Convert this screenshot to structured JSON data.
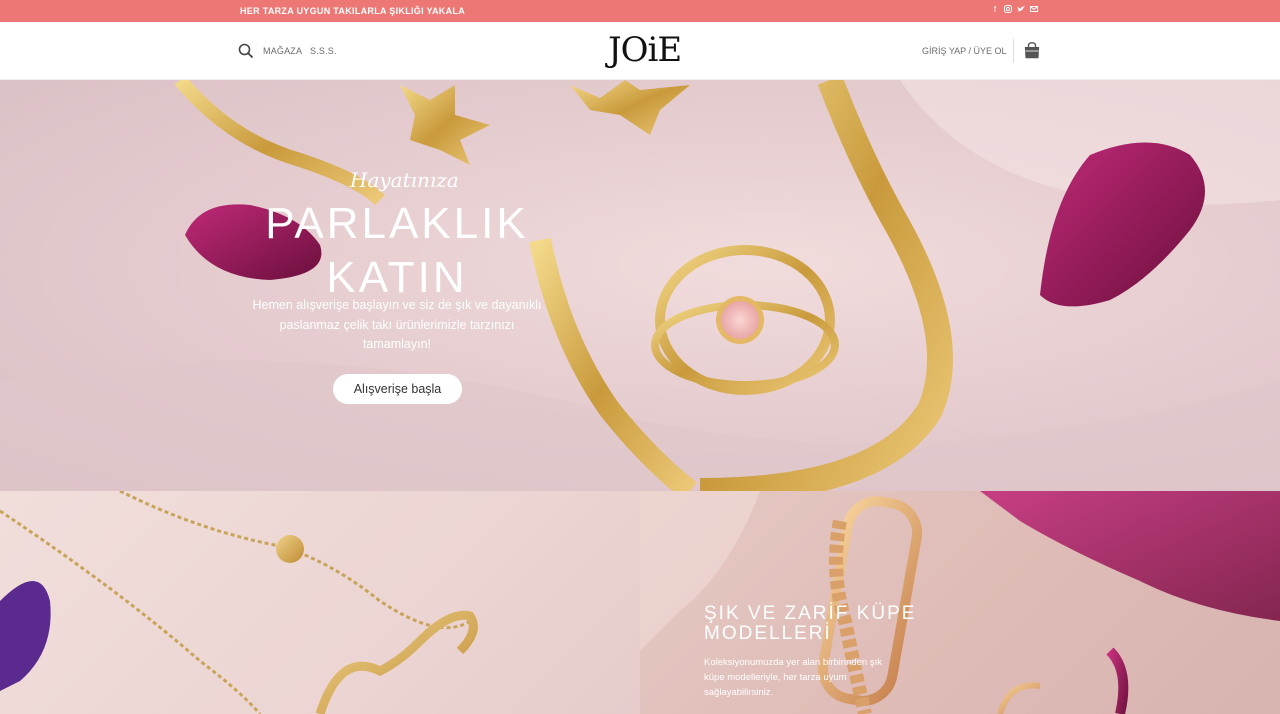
{
  "topbar": {
    "promo": "HER TARZA UYGUN TAKILARLA ŞIKLIĞI YAKALA",
    "social_icons": [
      "facebook-icon",
      "instagram-icon",
      "twitter-icon",
      "email-icon"
    ],
    "background": "#ed7774"
  },
  "header": {
    "nav": [
      "MAĞAZA",
      "S.S.S."
    ],
    "logo": "JOiE",
    "login": "GİRİŞ YAP / ÜYE OL",
    "icons": [
      "search-icon",
      "cart-icon"
    ]
  },
  "hero": {
    "script": "Hayatınıza",
    "headline_line1": "PARLAKLIK",
    "headline_line2": "KATIN",
    "desc_line1": "Hemen alışverişe başlayın ve siz de şık ve dayanıklı",
    "desc_line2": "paslanmaz çelik takı ürünlerimizle tarzınızı",
    "desc_line3": "tamamlayın!",
    "cta": "Alışverişe başla"
  },
  "panel_right": {
    "title_line1": "ŞIK VE ZARİF KÜPE",
    "title_line2": "MODELLERİ",
    "desc_line1": "Koleksiyonumuzda yer alan birbirinden şık",
    "desc_line2": "küpe modelleriyle, her tarza uyum",
    "desc_line3": "sağlayabilirsiniz."
  }
}
